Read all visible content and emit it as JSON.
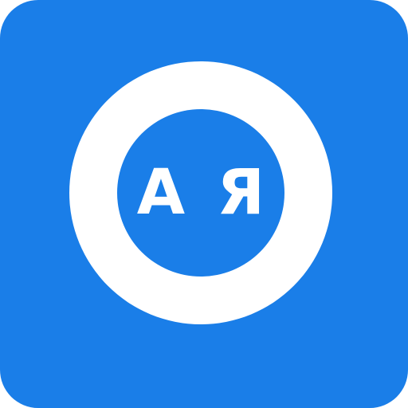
{
  "app_icon": {
    "name": "translate-app-icon",
    "background_color": "#1a7ee8",
    "ring_color": "#ffffff",
    "text_color": "#ffffff",
    "latin_letter": "A",
    "cyrillic_letter": "Я"
  }
}
